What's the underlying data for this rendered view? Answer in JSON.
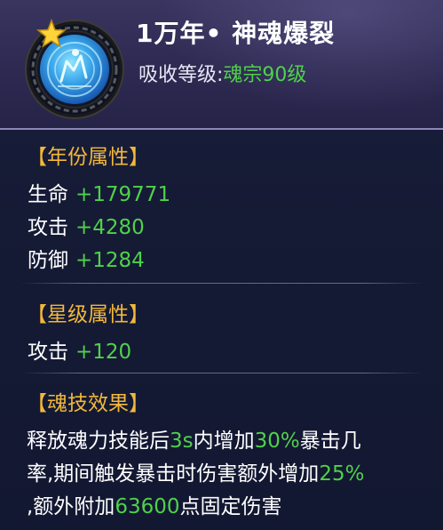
{
  "skill": {
    "title": "1万年• 神魂爆裂",
    "absorb_label": "吸收等级:",
    "absorb_value": "魂宗90级",
    "icon": "spirit-burst-skill-icon",
    "star_icon": "star-icon"
  },
  "year_attrs": {
    "heading": "【年份属性】",
    "rows": [
      {
        "label": "生命",
        "value": "+179771"
      },
      {
        "label": "攻击",
        "value": "+4280"
      },
      {
        "label": "防御",
        "value": "+1284"
      }
    ]
  },
  "star_attrs": {
    "heading": "【星级属性】",
    "rows": [
      {
        "label": "攻击",
        "value": "+120"
      }
    ]
  },
  "effect": {
    "heading": "【魂技效果】",
    "line1": {
      "a": "释放魂力技能后",
      "b": "3s",
      "c": "内增加",
      "d": "30%",
      "e": "暴击几"
    },
    "line2": {
      "a": "率,期间触发暴击时伤害额外增加",
      "b": "25%"
    },
    "line3": {
      "a": ",额外附加",
      "b": "63600",
      "c": "点固定伤害"
    }
  },
  "colors": {
    "accent_gold": "#f2b83a",
    "value_green": "#4fd14a",
    "text_white": "#ffffff",
    "panel_bg": "#151a35",
    "header_bg": "#2e2a52"
  }
}
